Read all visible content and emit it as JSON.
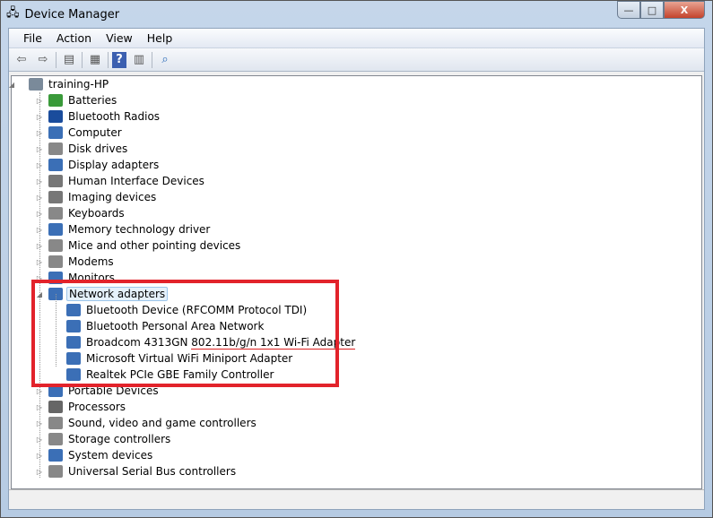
{
  "window": {
    "title": "Device Manager",
    "minimize": "—",
    "maximize": "□",
    "close": "X"
  },
  "menu": [
    "File",
    "Action",
    "View",
    "Help"
  ],
  "toolbar": {
    "icons": [
      "back-icon",
      "forward-icon",
      "show-hide-console-tree-icon",
      "properties-icon",
      "help-icon",
      "show-action-pane-icon",
      "scan-hardware-icon"
    ]
  },
  "tree": {
    "root": "training-HP",
    "categories": [
      {
        "label": "Batteries",
        "icon": "battery-icon",
        "color": "#3a9a3a"
      },
      {
        "label": "Bluetooth Radios",
        "icon": "bluetooth-icon",
        "color": "#1a4c9c"
      },
      {
        "label": "Computer",
        "icon": "computer-icon",
        "color": "#3b6fb6"
      },
      {
        "label": "Disk drives",
        "icon": "disk-icon",
        "color": "#888"
      },
      {
        "label": "Display adapters",
        "icon": "display-icon",
        "color": "#3b6fb6"
      },
      {
        "label": "Human Interface Devices",
        "icon": "hid-icon",
        "color": "#777"
      },
      {
        "label": "Imaging devices",
        "icon": "camera-icon",
        "color": "#777"
      },
      {
        "label": "Keyboards",
        "icon": "keyboard-icon",
        "color": "#888"
      },
      {
        "label": "Memory technology driver",
        "icon": "memory-icon",
        "color": "#3b6fb6"
      },
      {
        "label": "Mice and other pointing devices",
        "icon": "mouse-icon",
        "color": "#888"
      },
      {
        "label": "Modems",
        "icon": "modem-icon",
        "color": "#888"
      },
      {
        "label": "Monitors",
        "icon": "monitor-icon",
        "color": "#3b6fb6"
      },
      {
        "label": "Network adapters",
        "icon": "network-adapter-icon",
        "color": "#3b6fb6",
        "expanded": true,
        "selected": true,
        "children": [
          {
            "label": "Bluetooth Device (RFCOMM Protocol TDI)"
          },
          {
            "label": "Bluetooth Personal Area Network"
          },
          {
            "label": "Broadcom 4313GN ",
            "underlined": "802.11b/g/n 1x1 Wi-Fi Adapter"
          },
          {
            "label": "Microsoft Virtual WiFi Miniport Adapter"
          },
          {
            "label": "Realtek PCIe GBE Family Controller"
          }
        ]
      },
      {
        "label": "Portable Devices",
        "icon": "portable-device-icon",
        "color": "#3b6fb6"
      },
      {
        "label": "Processors",
        "icon": "processor-icon",
        "color": "#666"
      },
      {
        "label": "Sound, video and game controllers",
        "icon": "speaker-icon",
        "color": "#888"
      },
      {
        "label": "Storage controllers",
        "icon": "storage-icon",
        "color": "#888"
      },
      {
        "label": "System devices",
        "icon": "system-icon",
        "color": "#3b6fb6"
      },
      {
        "label": "Universal Serial Bus controllers",
        "icon": "usb-icon",
        "color": "#888"
      }
    ]
  },
  "colors": {
    "highlight": "#e2232b"
  }
}
